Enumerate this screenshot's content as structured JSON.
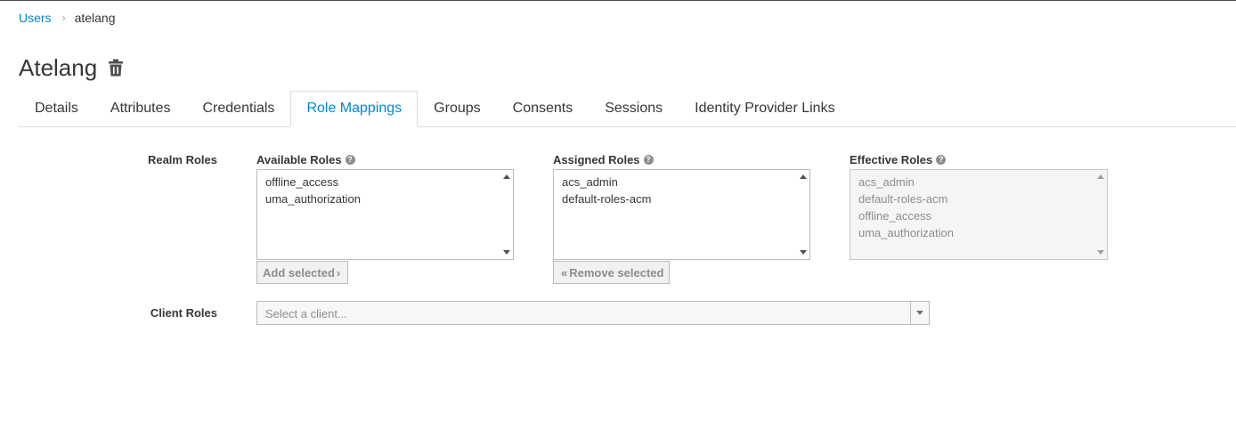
{
  "breadcrumb": {
    "parent": "Users",
    "separator": "›",
    "current": "atelang"
  },
  "page_title": "Atelang",
  "tabs": [
    {
      "label": "Details"
    },
    {
      "label": "Attributes"
    },
    {
      "label": "Credentials"
    },
    {
      "label": "Role Mappings",
      "active": true
    },
    {
      "label": "Groups"
    },
    {
      "label": "Consents"
    },
    {
      "label": "Sessions"
    },
    {
      "label": "Identity Provider Links"
    }
  ],
  "realm_roles": {
    "label": "Realm Roles",
    "available": {
      "heading": "Available Roles",
      "items": [
        "offline_access",
        "uma_authorization"
      ]
    },
    "assigned": {
      "heading": "Assigned Roles",
      "items": [
        "acs_admin",
        "default-roles-acm"
      ]
    },
    "effective": {
      "heading": "Effective Roles",
      "items": [
        "acs_admin",
        "default-roles-acm",
        "offline_access",
        "uma_authorization"
      ]
    },
    "add_button": "Add selected",
    "remove_button": "Remove selected"
  },
  "client_roles": {
    "label": "Client Roles",
    "placeholder": "Select a client..."
  },
  "colors": {
    "link": "#0088ce",
    "text": "#363636",
    "muted": "#8b8d8f"
  }
}
